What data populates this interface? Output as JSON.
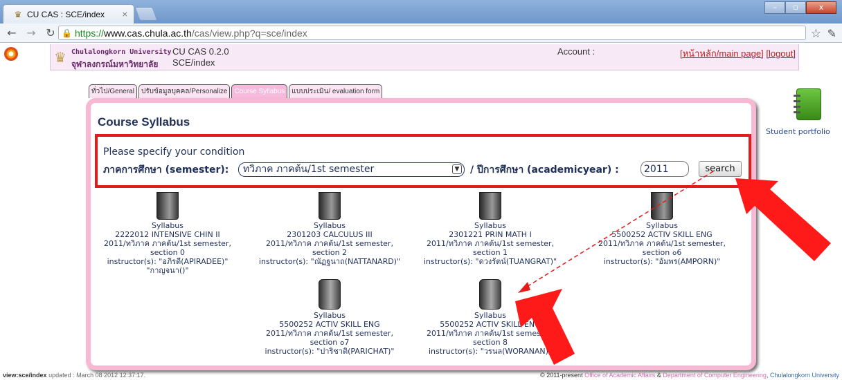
{
  "browser": {
    "tab_title": "CU CAS : SCE/index",
    "tab_close": "×",
    "url_scheme": "https://",
    "url_host": "www.cas.chula.ac.th",
    "url_path": "/cas/view.php?q=sce/index",
    "win_min": "–",
    "win_max": "▫",
    "win_close": "x"
  },
  "header": {
    "university_en": "Chulalongkorn University",
    "university_th": "จุฬาลงกรณ์มหาวิทยาลัย",
    "app_name": "CU CAS 0.2.0",
    "app_path": "SCE/index",
    "account_label": "Account :",
    "main_page_link": "[หน้าหลัก/main page]",
    "logout_link": "[logout]"
  },
  "tabs": [
    {
      "label": "ทั่วไป/General"
    },
    {
      "label": "ปรับข้อมูลบุคคล/Personalize"
    },
    {
      "label": "Course Syllabus"
    },
    {
      "label": "แบบประเมิน/ evaluation form"
    }
  ],
  "main": {
    "title": "Course Syllabus",
    "condition_label": "Please specify your condition",
    "semester_label": "ภาคการศึกษา (semester):",
    "semester_value": "ทวิภาค ภาคต้น/1st semester",
    "year_label": "/ ปีการศึกษา (academicyear) :",
    "year_value": "2011",
    "search_label": "search"
  },
  "syllabi": [
    {
      "link": "Syllabus",
      "course": "2222012 INTENSIVE CHIN II",
      "term": "2011/ทวิภาค ภาคต้น/1st semester,",
      "section": "section 0",
      "instructor": "instructor(s): \"อภิรดี(APIRADEE)\"",
      "extra": "\"กาญจนา()\""
    },
    {
      "link": "Syllabus",
      "course": "2301203 CALCULUS III",
      "term": "2011/ทวิภาค ภาคต้น/1st semester,",
      "section": "section 2",
      "instructor": "instructor(s): \"ณัฏฐนาถ(NATTANARD)\"",
      "extra": ""
    },
    {
      "link": "Syllabus",
      "course": "2301221 PRIN MATH I",
      "term": "2011/ทวิภาค ภาคต้น/1st semester,",
      "section": "section 1",
      "instructor": "instructor(s): \"ดวงรัตน์(TUANGRAT)\"",
      "extra": ""
    },
    {
      "link": "Syllabus",
      "course": "5500252 ACTIV SKILL ENG",
      "term": "2011/ทวิภาค ภาคต้น/1st semester,",
      "section": "section ๐6",
      "instructor": "instructor(s): \"อัมพร(AMPORN)\"",
      "extra": ""
    },
    {
      "link": "Syllabus",
      "course": "5500252 ACTIV SKILL ENG",
      "term": "2011/ทวิภาค ภาคต้น/1st semester,",
      "section": "section ๐7",
      "instructor": "instructor(s): \"ปาริชาติ(PARICHAT)\"",
      "extra": ""
    },
    {
      "link": "Syllabus",
      "course": "5500252 ACTIV SKILL ENG",
      "term": "2011/ทวิภาค ภาคต้น/1st semester,",
      "section": "section 8",
      "instructor": "instructor(s): \"วรนล(WORANAN)\"",
      "extra": ""
    }
  ],
  "portfolio": {
    "label": "Student portfolio"
  },
  "footer": {
    "view_label": "view:sce/index",
    "updated_text": "updated : March 08 2012 12:37:17.",
    "copyright": "© 2011-present",
    "office": "Office of Academic Affairs",
    "amp": "&",
    "dept": "Department of Computer Engineering",
    "university": ", Chulalongkorn University"
  },
  "annotation_colors": {
    "box": "#e41b1b",
    "arrow": "#ff1a1a"
  }
}
